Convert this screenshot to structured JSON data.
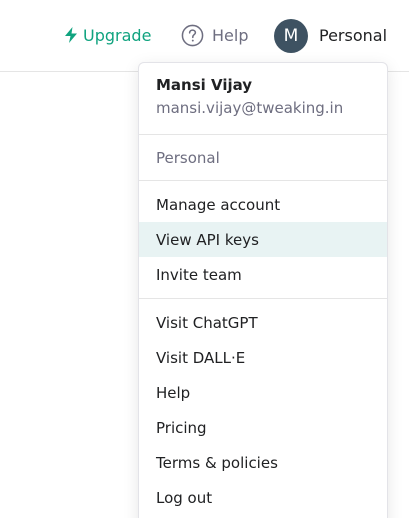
{
  "topbar": {
    "upgrade_label": "Upgrade",
    "help_label": "Help",
    "account_label": "Personal",
    "avatar_initial": "M"
  },
  "menu": {
    "user_name": "Mansi Vijay",
    "user_email": "mansi.vijay@tweaking.in",
    "org_label": "Personal",
    "account_items": [
      {
        "label": "Manage account"
      },
      {
        "label": "View API keys"
      },
      {
        "label": "Invite team"
      }
    ],
    "link_items": [
      {
        "label": "Visit ChatGPT"
      },
      {
        "label": "Visit DALL·E"
      },
      {
        "label": "Help"
      },
      {
        "label": "Pricing"
      },
      {
        "label": "Terms & policies"
      },
      {
        "label": "Log out"
      }
    ],
    "highlighted_item": "View API keys"
  },
  "colors": {
    "accent_green": "#10a37f",
    "avatar_bg": "#3e5262",
    "highlight_bg": "#e8f3f3",
    "muted_text": "#6e6e80"
  },
  "icons": {
    "upgrade": "lightning-bolt-icon",
    "help": "question-circle-icon"
  }
}
